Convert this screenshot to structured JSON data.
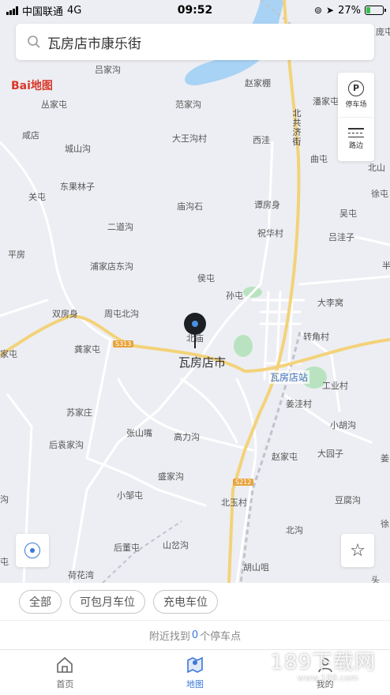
{
  "status_bar": {
    "carrier": "中国联通",
    "network": "4G",
    "time": "09:52",
    "battery_percent_label": "27%",
    "battery_level": 0.27
  },
  "search": {
    "value": "瓦房店市康乐街"
  },
  "map": {
    "logo": "Bai地图",
    "place_labels": [
      "吕家沟",
      "赵家棚",
      "庞屯",
      "丛家屯",
      "范家沟",
      "潘家屯",
      "咸店",
      "大王沟村",
      "西洼",
      "曲屯",
      "城山沟",
      "东果林子",
      "北山",
      "关屯",
      "徐屯",
      "庙沟石",
      "谭房身",
      "吴屯",
      "二道沟",
      "祝华村",
      "吕洼子",
      "平房",
      "浦家店东沟",
      "侯屯",
      "半",
      "孙屯",
      "大李窝",
      "双房身",
      "周屯北沟",
      "转角村",
      "家屯",
      "北庙",
      "龚家屯",
      "工业村",
      "苏家庄",
      "姜洼村",
      "小胡沟",
      "后袁家沟",
      "张山嘴",
      "高力沟",
      "赵家屯",
      "大园子",
      "姜",
      "盛家沟",
      "北玉村",
      "小邹屯",
      "豆腐沟",
      "沟",
      "徐",
      "后董屯",
      "山岔沟",
      "北沟",
      "屯",
      "荷花湾",
      "胡山咀",
      "头"
    ],
    "city_label": "瓦房店市",
    "station_label": "瓦房店站",
    "road_badges": [
      "S313",
      "S212"
    ],
    "street_label": "北共济街"
  },
  "side_panel": {
    "parking_glyph": "P",
    "parking_label": "停车场",
    "roadside_label": "路边"
  },
  "favorite_glyph": "☆",
  "filters": [
    "全部",
    "可包月车位",
    "充电车位"
  ],
  "result": {
    "prefix": "附近找到",
    "count": "0",
    "suffix": "个停车点"
  },
  "tabs": [
    {
      "label": "首页",
      "icon": "home-icon"
    },
    {
      "label": "地图",
      "icon": "map-icon"
    },
    {
      "label": "我的",
      "icon": "user-icon"
    }
  ],
  "watermark": {
    "main": "189下载网",
    "sub": "www.189.com"
  },
  "colors": {
    "accent": "#3c78d8",
    "highway": "#f3d27a",
    "battery": "#33c24d",
    "water": "#a9d3f5",
    "green": "#b9e3c0"
  }
}
